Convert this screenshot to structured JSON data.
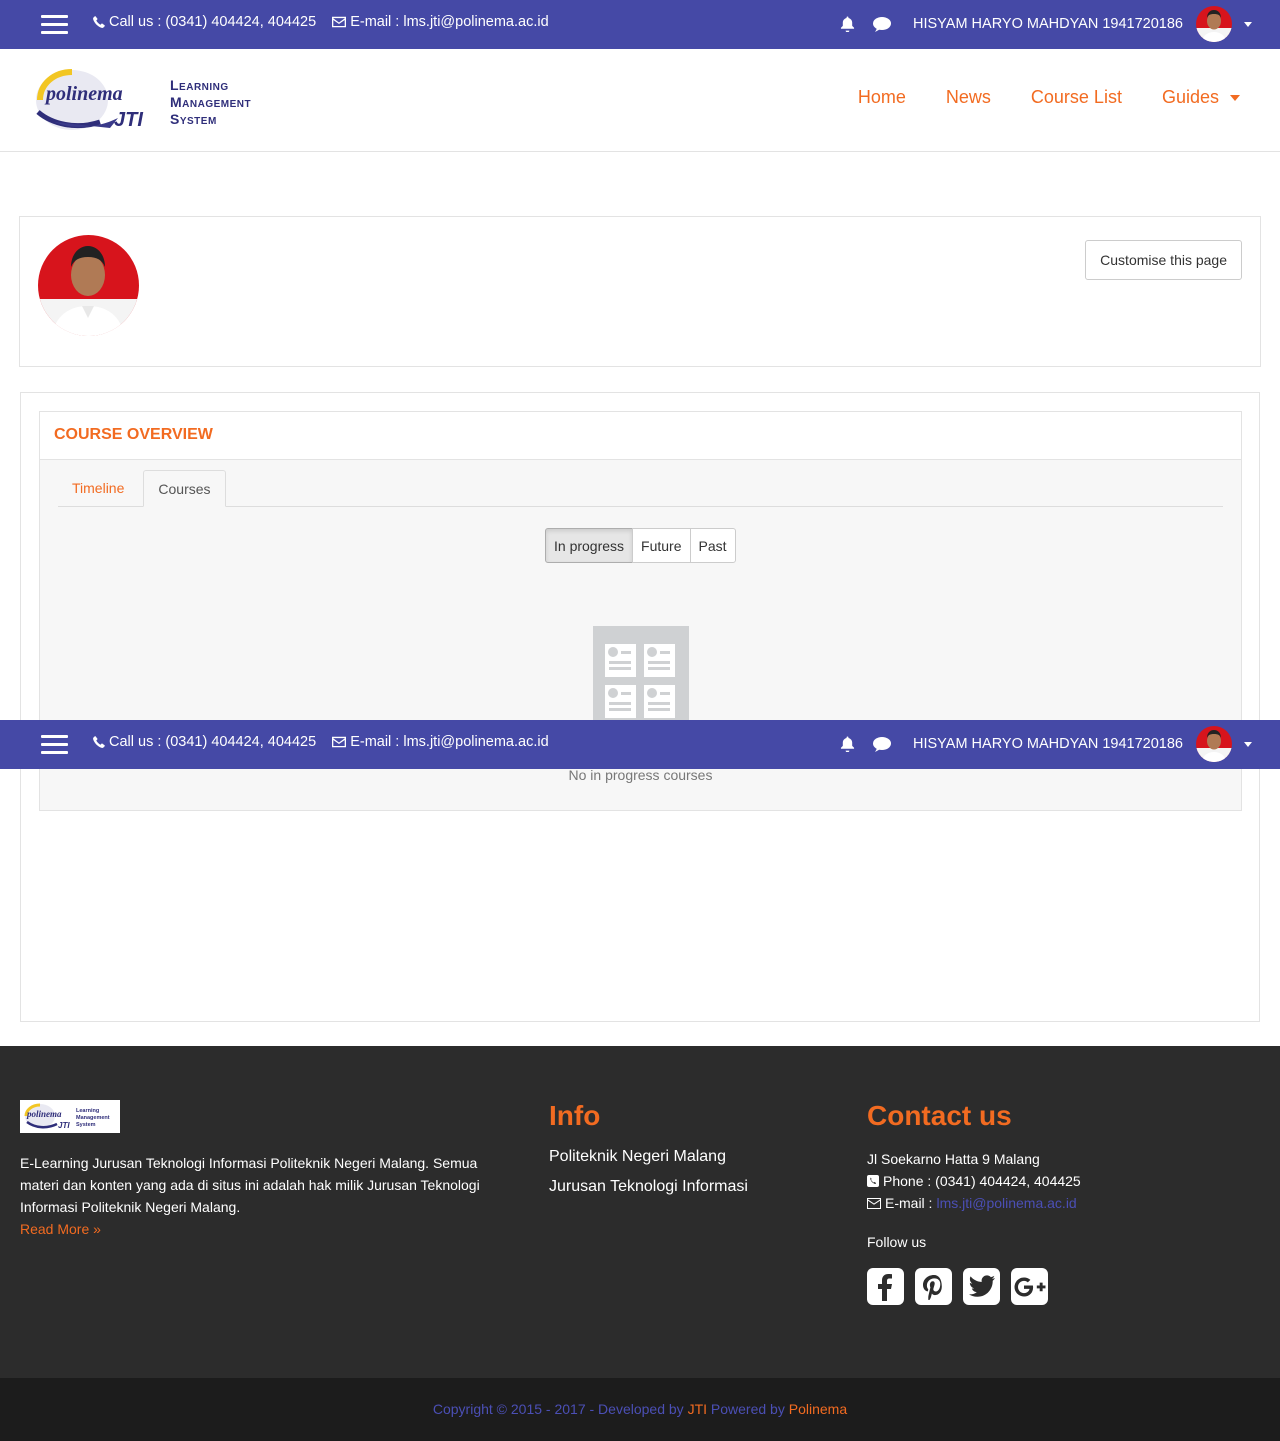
{
  "topbar": {
    "call_label": "Call us : (0341) 404424, 404425",
    "email_label": "E-mail : lms.jti@polinema.ac.id",
    "username": "HISYAM HARYO MAHDYAN 1941720186"
  },
  "logo": {
    "line1": "Learning",
    "line2": "Management",
    "line3": "System",
    "mark": "polinema",
    "sub": "JTI"
  },
  "nav": {
    "items": [
      "Home",
      "News",
      "Course List",
      "Guides"
    ]
  },
  "profile": {
    "customise_label": "Customise this page"
  },
  "course_overview": {
    "title": "COURSE OVERVIEW",
    "tabs": [
      "Timeline",
      "Courses"
    ],
    "active_tab": "Courses",
    "filters": [
      "In progress",
      "Future",
      "Past"
    ],
    "active_filter": "In progress",
    "empty_text": "No in progress courses"
  },
  "footer": {
    "description": "E-Learning Jurusan Teknologi Informasi Politeknik Negeri Malang. Semua materi dan konten yang ada di situs ini adalah hak milik Jurusan Teknologi Informasi Politeknik Negeri Malang.",
    "read_more": "Read More »",
    "info_title": "Info",
    "info_links": [
      "Politeknik Negeri Malang",
      "Jurusan Teknologi Informasi"
    ],
    "contact_title": "Contact us",
    "address": "Jl Soekarno Hatta 9 Malang",
    "phone": "Phone : (0341) 404424, 404425",
    "email_label": "E-mail :",
    "email": "lms.jti@polinema.ac.id",
    "follow_us": "Follow us",
    "social": [
      "facebook-icon",
      "pinterest-icon",
      "twitter-icon",
      "google-plus-icon"
    ]
  },
  "copyright": {
    "prefix": "Copyright © 2015 - 2017 - Developed by",
    "jti": "JTI",
    "powered": "Powered by",
    "polinema": "Polinema"
  },
  "colors": {
    "topbar": "#4549a6",
    "accent": "#f26b21",
    "footer_bg": "#2c2c2c",
    "copyright_bg": "#1c1c1c"
  }
}
